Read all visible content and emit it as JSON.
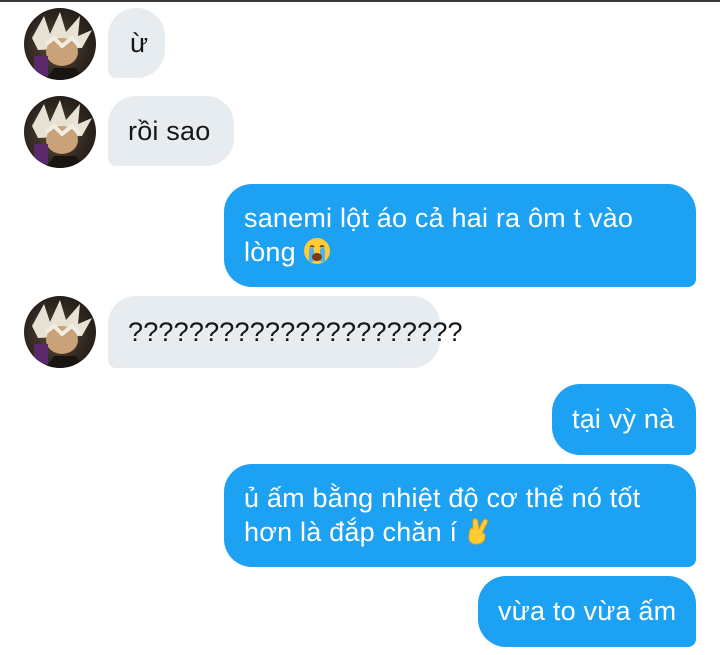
{
  "messages": [
    {
      "side": "in",
      "text": "ừ"
    },
    {
      "side": "in",
      "text": "rồi sao"
    },
    {
      "side": "out",
      "line1": "sanemi lột áo cả hai ra ôm t vào",
      "line2": "lòng",
      "emoji": "loudly-crying-face-icon"
    },
    {
      "side": "in",
      "text": "??????????????????????"
    },
    {
      "side": "out",
      "text": "tại vỳ nà"
    },
    {
      "side": "out",
      "line1": "ủ ấm bằng nhiệt độ cơ thể nó tốt",
      "line2": "hơn là đắp chăn í",
      "emoji": "crossed-fingers-icon"
    },
    {
      "side": "out",
      "text": "vừa to vừa ấm"
    }
  ],
  "colors": {
    "incoming_bubble": "#e6ecf0",
    "outgoing_bubble": "#1da1f2",
    "incoming_text": "#14171a",
    "outgoing_text": "#ffffff"
  }
}
